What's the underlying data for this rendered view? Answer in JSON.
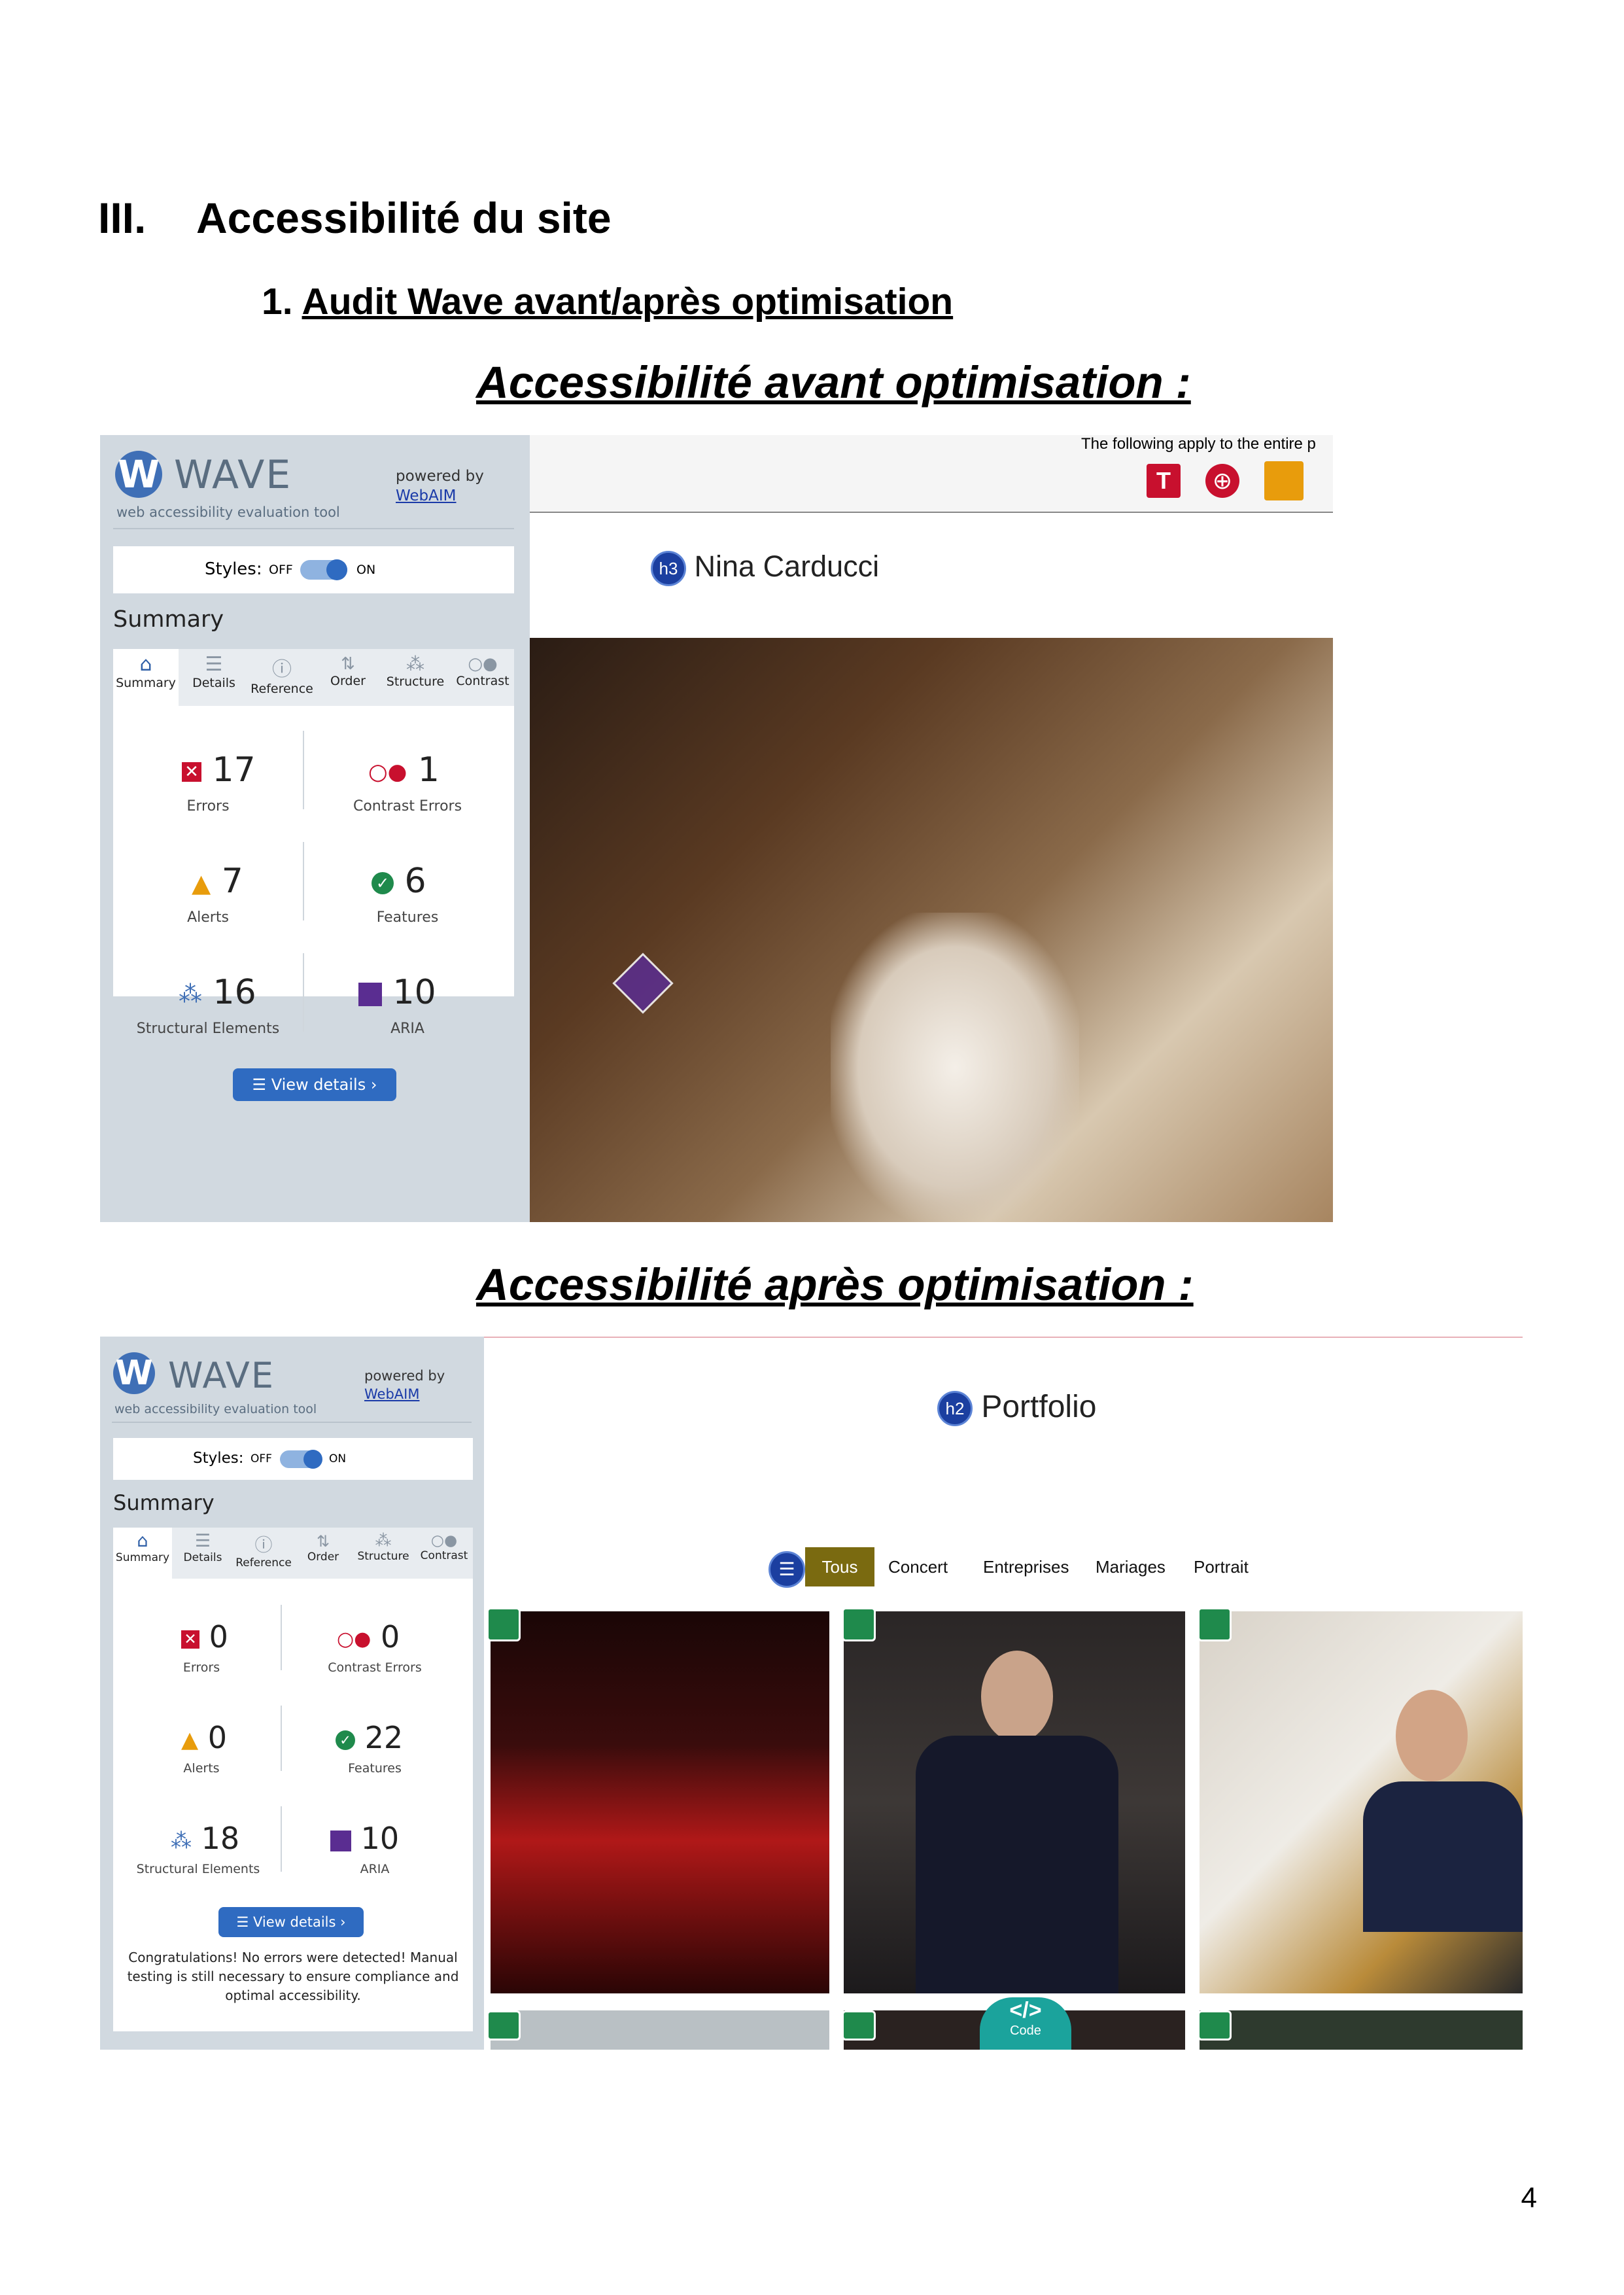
{
  "heading": {
    "number": "III.",
    "title": "Accessibilité du site"
  },
  "subheading": {
    "number": "1.",
    "title": "Audit Wave avant/après optimisation"
  },
  "before": {
    "caption": "Accessibilité avant optimisation :",
    "wave": {
      "logo_text": "WAVE",
      "tagline": "web accessibility evaluation tool",
      "powered_by": "powered by",
      "webaim_link": "WebAIM",
      "styles_label": "Styles:",
      "off_label": "OFF",
      "on_label": "ON",
      "summary_title": "Summary",
      "tabs": [
        "Summary",
        "Details",
        "Reference",
        "Order",
        "Structure",
        "Contrast"
      ],
      "stats": {
        "errors": {
          "value": "17",
          "label": "Errors"
        },
        "contrast_errors": {
          "value": "1",
          "label": "Contrast Errors"
        },
        "alerts": {
          "value": "7",
          "label": "Alerts"
        },
        "features": {
          "value": "6",
          "label": "Features"
        },
        "structural": {
          "value": "16",
          "label": "Structural Elements"
        },
        "aria": {
          "value": "10",
          "label": "ARIA"
        }
      },
      "view_details": "View details ›"
    },
    "site": {
      "notice": "The following apply to the entire p",
      "heading_badge": "h3",
      "heading_text": "Nina Carducci"
    }
  },
  "after": {
    "caption": "Accessibilité après optimisation :",
    "wave": {
      "logo_text": "WAVE",
      "tagline": "web accessibility evaluation tool",
      "powered_by": "powered by",
      "webaim_link": "WebAIM",
      "styles_label": "Styles:",
      "off_label": "OFF",
      "on_label": "ON",
      "summary_title": "Summary",
      "tabs": [
        "Summary",
        "Details",
        "Reference",
        "Order",
        "Structure",
        "Contrast"
      ],
      "stats": {
        "errors": {
          "value": "0",
          "label": "Errors"
        },
        "contrast_errors": {
          "value": "0",
          "label": "Contrast Errors"
        },
        "alerts": {
          "value": "0",
          "label": "Alerts"
        },
        "features": {
          "value": "22",
          "label": "Features"
        },
        "structural": {
          "value": "18",
          "label": "Structural Elements"
        },
        "aria": {
          "value": "10",
          "label": "ARIA"
        }
      },
      "view_details": "View details ›",
      "congrats": "Congratulations! No errors were detected! Manual testing is still necessary to ensure compliance and optimal accessibility."
    },
    "site": {
      "heading_badge": "h2",
      "heading_text": "Portfolio",
      "filters": [
        "Tous",
        "Concert",
        "Entreprises",
        "Mariages",
        "Portrait"
      ],
      "code_badge": "Code"
    }
  },
  "page_number": "4",
  "colors": {
    "wave_panel": "#d1d9e0",
    "wave_blue": "#2f6bc1",
    "error_red": "#c8102e",
    "alert_orange": "#e89c0c",
    "feature_green": "#1f8a4c",
    "aria_purple": "#5a2d91",
    "filter_active": "#7a6a10"
  },
  "icons": [
    "wave-logo",
    "home-icon",
    "list-icon",
    "info-icon",
    "order-icon",
    "structure-icon",
    "contrast-icon",
    "error-icon",
    "contrast-error-icon",
    "alert-icon",
    "feature-icon",
    "structure-icon",
    "aria-icon",
    "image-alt-icon",
    "code-icon"
  ]
}
